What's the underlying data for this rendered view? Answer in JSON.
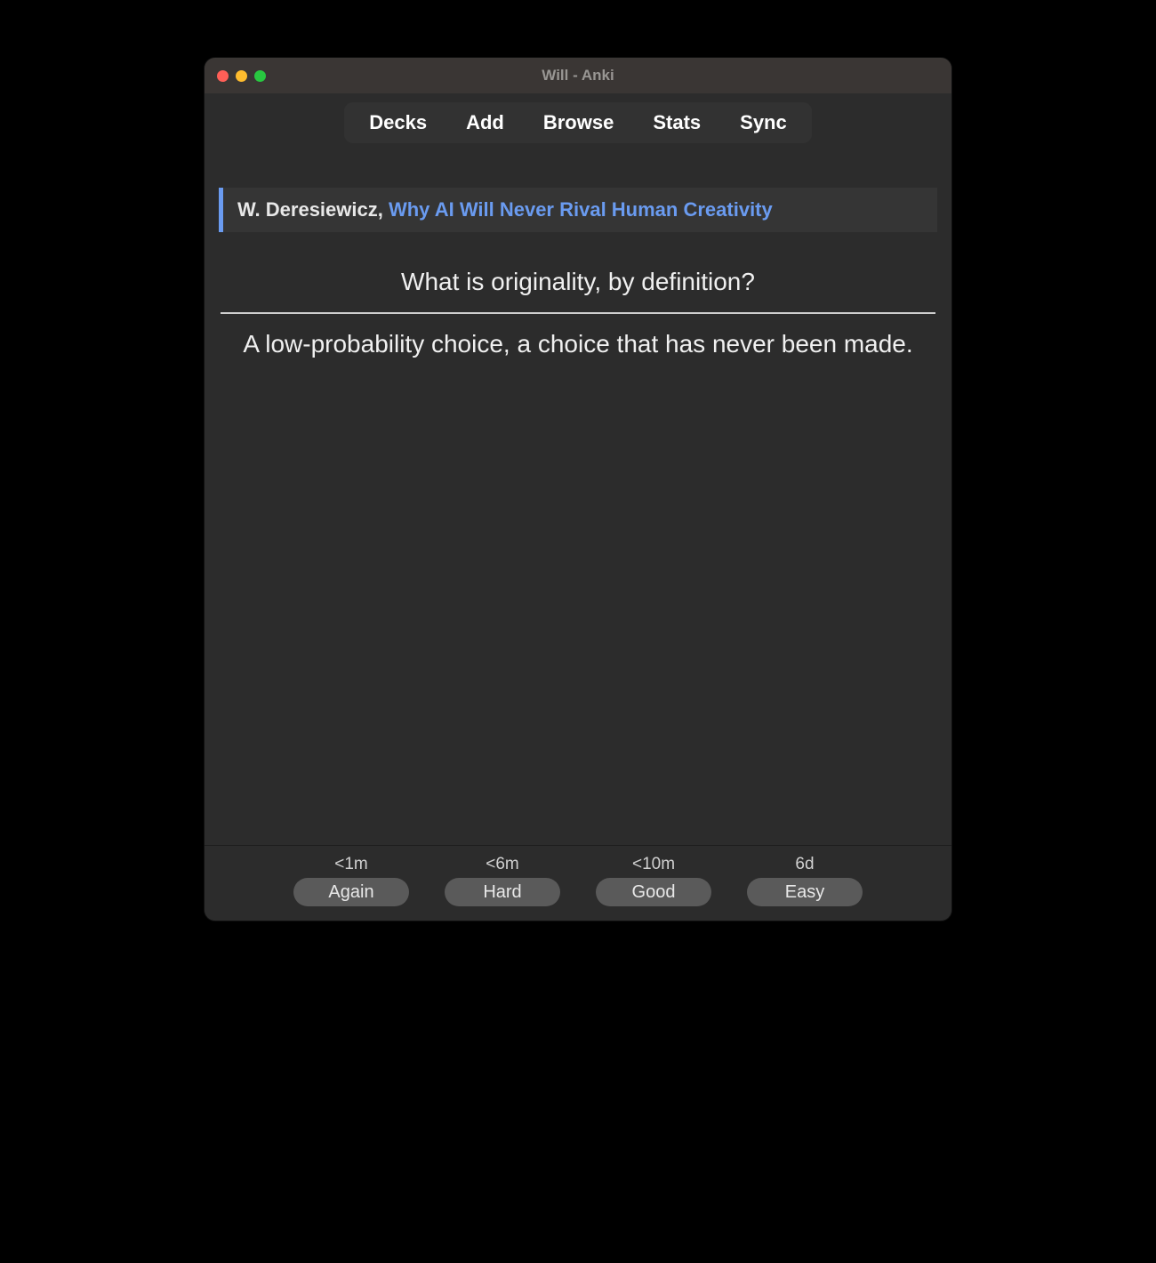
{
  "window": {
    "title": "Will - Anki"
  },
  "toolbar": {
    "decks": "Decks",
    "add": "Add",
    "browse": "Browse",
    "stats": "Stats",
    "sync": "Sync"
  },
  "card": {
    "source_author": "W. Deresiewicz, ",
    "source_title": "Why AI Will Never Rival Human Creativity",
    "question": "What is originality, by definition?",
    "answer": "A low-probability choice, a choice that has never been made."
  },
  "ease": {
    "again": {
      "time": "<1m",
      "label": "Again"
    },
    "hard": {
      "time": "<6m",
      "label": "Hard"
    },
    "good": {
      "time": "<10m",
      "label": "Good"
    },
    "easy": {
      "time": "6d",
      "label": "Easy"
    }
  }
}
